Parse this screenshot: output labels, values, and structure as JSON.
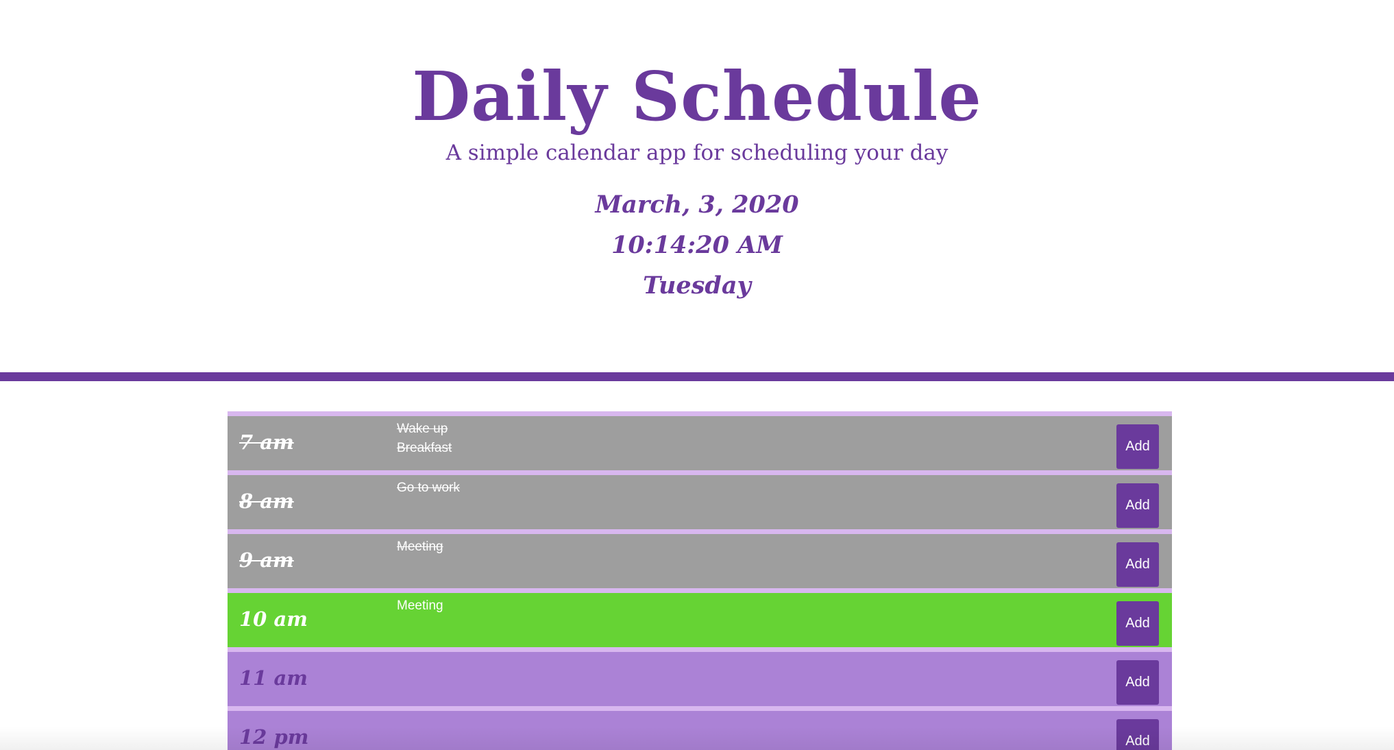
{
  "header": {
    "title": "Daily Schedule",
    "subtitle": "A simple calendar app for scheduling your day",
    "date": "March, 3, 2020",
    "time": "10:14:20 AM",
    "day": "Tuesday"
  },
  "colors": {
    "accent": "#6a3a9c",
    "past": "#9e9e9e",
    "present": "#66d334",
    "future": "#ab82d6",
    "row_border": "#d8b7ef"
  },
  "schedule": {
    "rows": [
      {
        "hour": "7 am",
        "status": "past",
        "tasks": [
          "Wake up",
          "Breakfast"
        ],
        "button": "Add"
      },
      {
        "hour": "8 am",
        "status": "past",
        "tasks": [
          "Go to work"
        ],
        "button": "Add"
      },
      {
        "hour": "9 am",
        "status": "past",
        "tasks": [
          "Meeting"
        ],
        "button": "Add"
      },
      {
        "hour": "10 am",
        "status": "present",
        "tasks": [
          "Meeting"
        ],
        "button": "Add"
      },
      {
        "hour": "11 am",
        "status": "future",
        "tasks": [],
        "button": "Add"
      },
      {
        "hour": "12 pm",
        "status": "future",
        "tasks": [],
        "button": "Add"
      }
    ]
  }
}
